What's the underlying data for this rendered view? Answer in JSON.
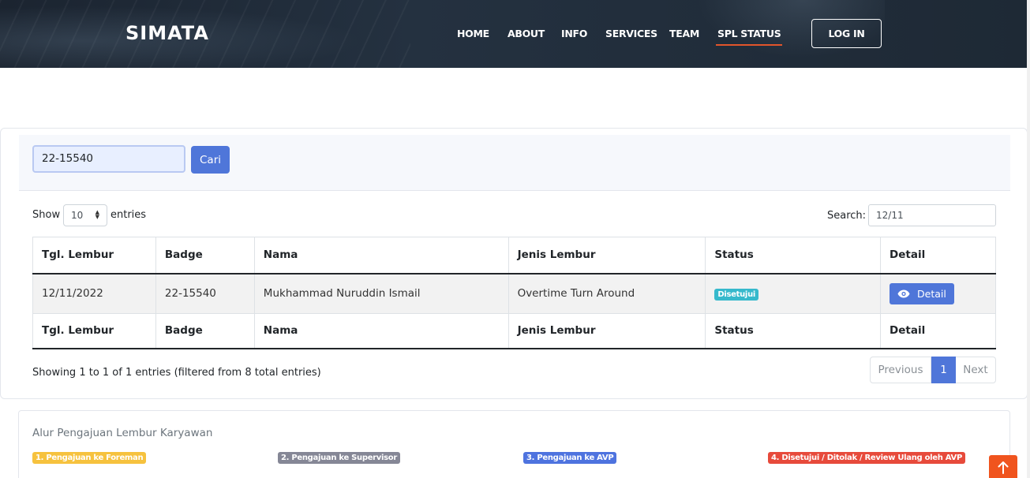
{
  "header": {
    "brand": "SIMATA",
    "nav": [
      {
        "label": "HOME"
      },
      {
        "label": "ABOUT"
      },
      {
        "label": "INFO"
      },
      {
        "label": "SERVICES"
      },
      {
        "label": "TEAM"
      },
      {
        "label": "SPL STATUS",
        "active": true
      }
    ],
    "login_label": "LOG IN"
  },
  "search": {
    "badge_value": "22-15540",
    "button_label": "Cari"
  },
  "table_controls": {
    "show_label": "Show",
    "length_value": "10",
    "entries_label": "entries",
    "search_label": "Search:",
    "search_value": "12/11"
  },
  "table": {
    "columns": [
      "Tgl. Lembur",
      "Badge",
      "Nama",
      "Jenis Lembur",
      "Status",
      "Detail"
    ],
    "rows": [
      {
        "tgl": "12/11/2022",
        "badge": "22-15540",
        "nama": "Mukhammad Nuruddin Ismail",
        "jenis": "Overtime Turn Around",
        "status": "Disetujui",
        "detail_label": "Detail"
      }
    ]
  },
  "footer_info": {
    "text": "Showing 1 to 1 of 1 entries (filtered from 8 total entries)"
  },
  "pagination": {
    "previous": "Previous",
    "current": "1",
    "next": "Next"
  },
  "flow": {
    "title": "Alur Pengajuan Lembur Karyawan",
    "steps": [
      {
        "label": "1. Pengajuan ke Foreman",
        "color": "#f6c23e"
      },
      {
        "label": "2. Pengajuan ke Supervisor",
        "color": "#858796"
      },
      {
        "label": "3. Pengajuan ke AVP",
        "color": "#4e73df"
      },
      {
        "label": "4. Disetujui / Ditolak / Review Ulang oleh AVP",
        "color": "#e74a3b"
      }
    ]
  },
  "colors": {
    "primary": "#4f76d9",
    "accent": "#e2552b",
    "header_bg": "#1b2430",
    "status_info": "#36b9cc"
  },
  "icons": {
    "detail": "eye-icon",
    "scroll_top": "arrow-up-icon"
  }
}
